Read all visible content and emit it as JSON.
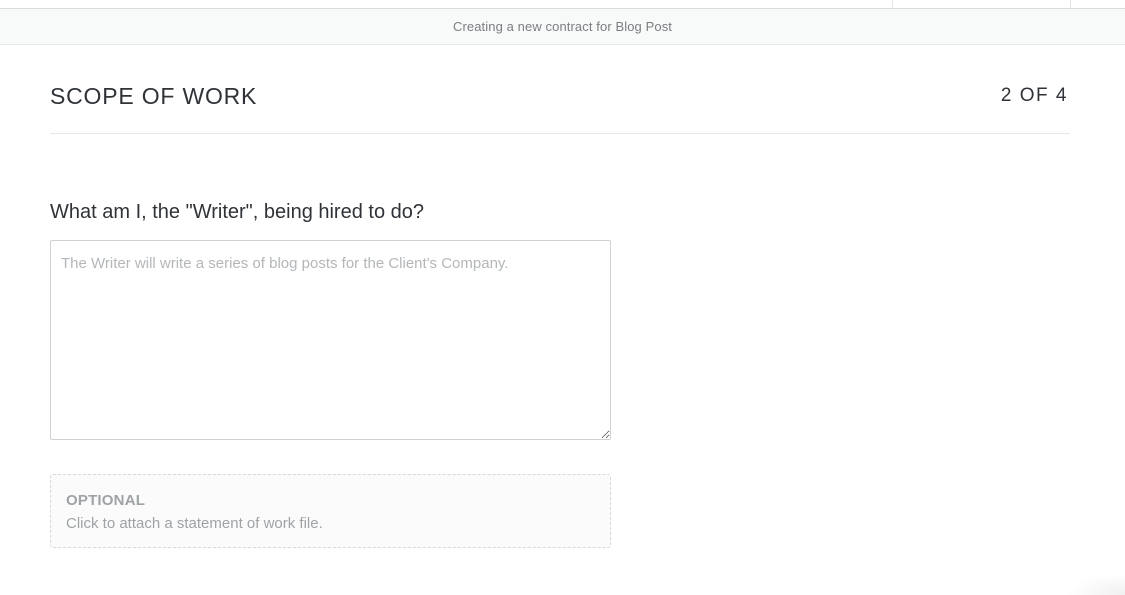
{
  "subheader": {
    "text": "Creating a new contract for Blog Post"
  },
  "section": {
    "title": "SCOPE OF WORK",
    "step": "2 OF 4"
  },
  "question": {
    "label": "What am I, the \"Writer\", being hired to do?",
    "placeholder": "The Writer will write a series of blog posts for the Client's Company.",
    "value": ""
  },
  "attachment": {
    "label": "OPTIONAL",
    "text": "Click to attach a statement of work file."
  }
}
